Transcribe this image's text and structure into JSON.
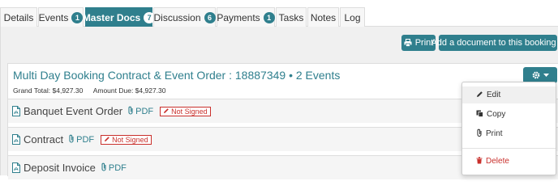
{
  "tabs": [
    {
      "label": "Details",
      "badge": null
    },
    {
      "label": "Events",
      "badge": "1"
    },
    {
      "label": "Master Docs",
      "badge": "7",
      "active": true
    },
    {
      "label": "Discussion",
      "badge": "6"
    },
    {
      "label": "Payments",
      "badge": "1"
    },
    {
      "label": "Tasks",
      "badge": null
    },
    {
      "label": "Notes",
      "badge": null
    },
    {
      "label": "Log",
      "badge": null
    }
  ],
  "toolbar": {
    "print_label": "Print",
    "add_document_label": "Add a document to this booking"
  },
  "card": {
    "title": "Multi Day Booking Contract & Event Order : 18887349 • 2 Events",
    "grand_total": "Grand Total: $4,927.30",
    "amount_due": "Amount Due: $4,927.30"
  },
  "documents": [
    {
      "name": "Banquet Event Order",
      "link": "PDF",
      "status": "Not Signed"
    },
    {
      "name": "Contract",
      "link": "PDF",
      "status": "Not Signed"
    },
    {
      "name": "Deposit Invoice",
      "link": "PDF",
      "status": null
    }
  ],
  "menu": {
    "items": [
      {
        "label": "Edit",
        "icon": "pencil-icon"
      },
      {
        "label": "Copy",
        "icon": "copy-icon"
      },
      {
        "label": "Print",
        "icon": "paperclip-icon"
      },
      {
        "label": "Delete",
        "icon": "trash-icon"
      }
    ]
  },
  "colors": {
    "accent": "#2f7f8d",
    "danger": "#c9302c",
    "panel_bg": "#f0f0f0"
  }
}
